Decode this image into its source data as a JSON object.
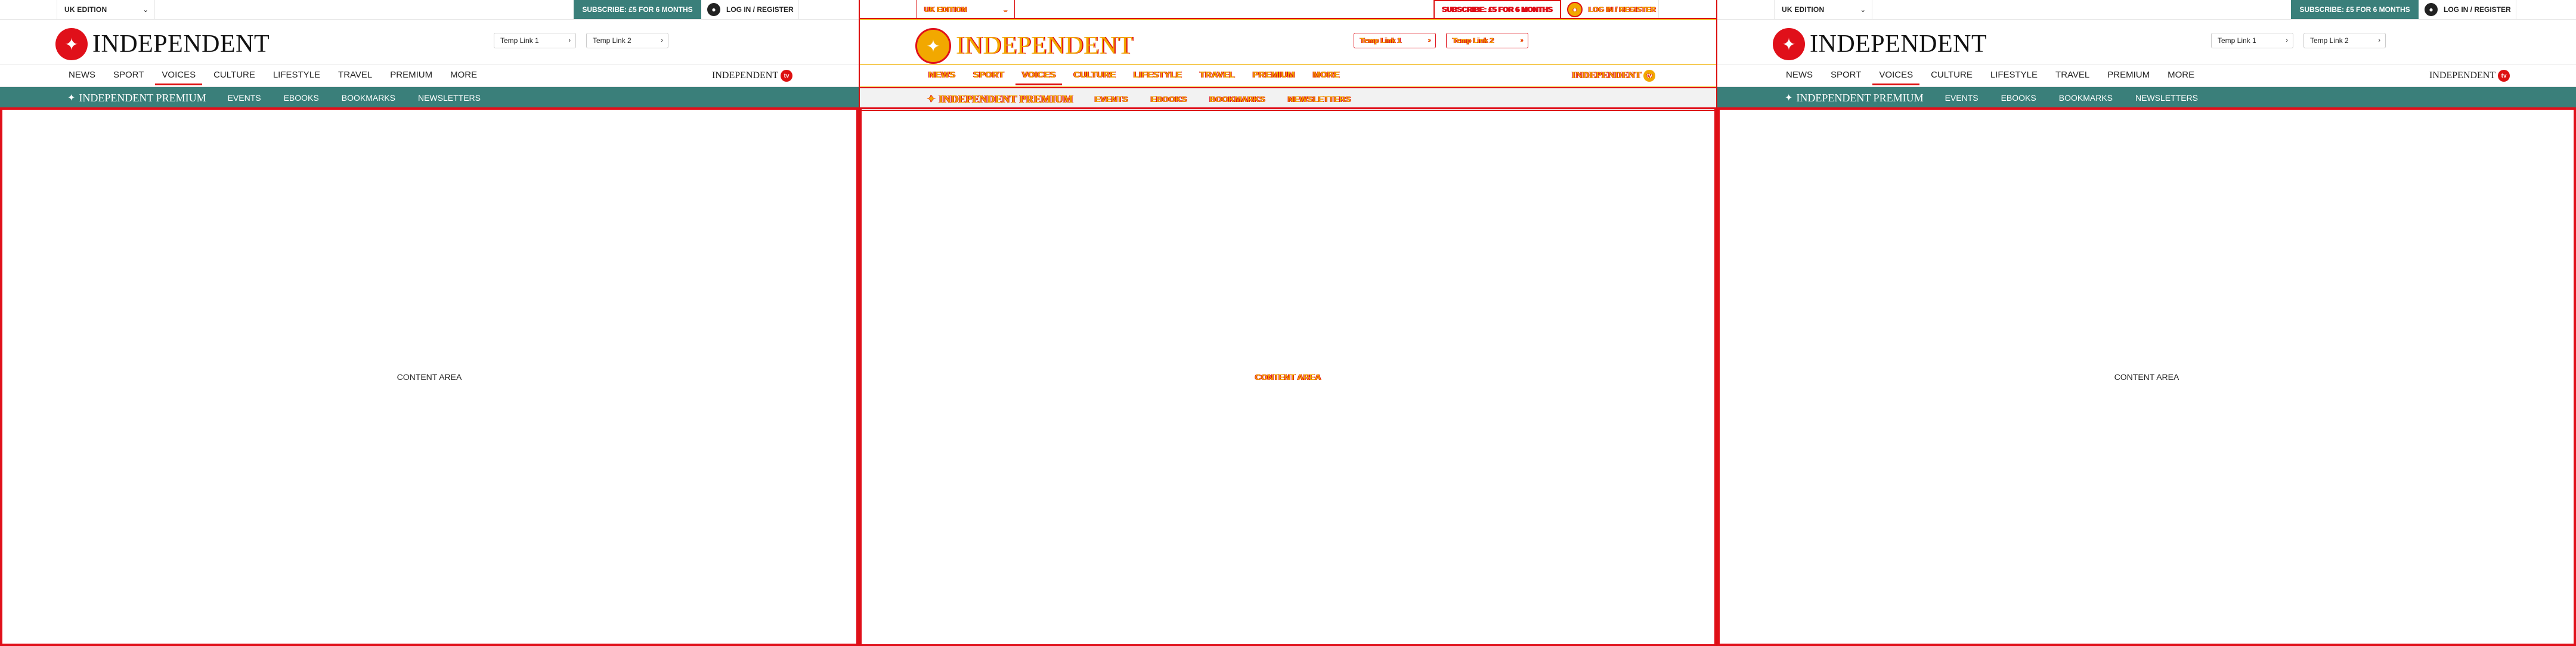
{
  "topbar": {
    "edition": "UK EDITION",
    "subscribe": "SUBSCRIBE: £5 FOR 6 MONTHS",
    "login": "LOG IN / REGISTER"
  },
  "masthead": {
    "logo": "INDEPENDENT",
    "temp_link_1": "Temp Link 1",
    "temp_link_2": "Temp Link 2"
  },
  "nav": {
    "items": [
      "NEWS",
      "SPORT",
      "VOICES",
      "CULTURE",
      "LIFESTYLE",
      "TRAVEL",
      "PREMIUM",
      "MORE"
    ],
    "active": "VOICES",
    "tv_logo": "INDEPENDENT",
    "tv_badge": "tv"
  },
  "premium": {
    "logo": "INDEPENDENT PREMIUM",
    "links": [
      "EVENTS",
      "EBOOKS",
      "BOOKMARKS",
      "NEWSLETTERS"
    ]
  },
  "content": {
    "label": "CONTENT AREA"
  },
  "colors": {
    "brand_red": "#e0101a",
    "teal": "#3a7f7a"
  }
}
